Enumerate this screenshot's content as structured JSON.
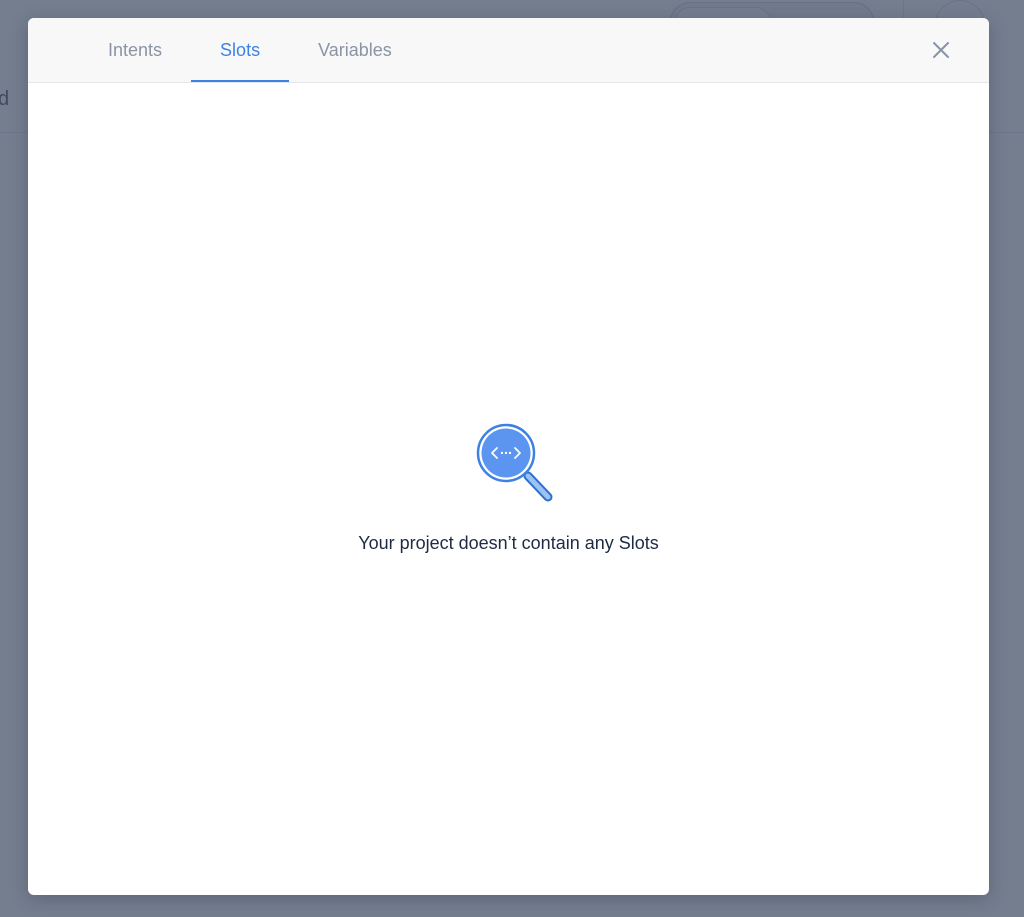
{
  "background": {
    "fragment_text": "d"
  },
  "modal": {
    "tabs": [
      {
        "label": "Intents",
        "active": false
      },
      {
        "label": "Slots",
        "active": true
      },
      {
        "label": "Variables",
        "active": false
      }
    ],
    "close_icon": "close-icon",
    "empty_state": {
      "icon": "magnifier-code-icon",
      "message": "Your project doesn’t contain any Slots"
    }
  },
  "colors": {
    "accent": "#3d82e2",
    "tab_inactive": "#8a94a6",
    "overlay": "#404c64",
    "text_dark": "#1d2b44"
  }
}
